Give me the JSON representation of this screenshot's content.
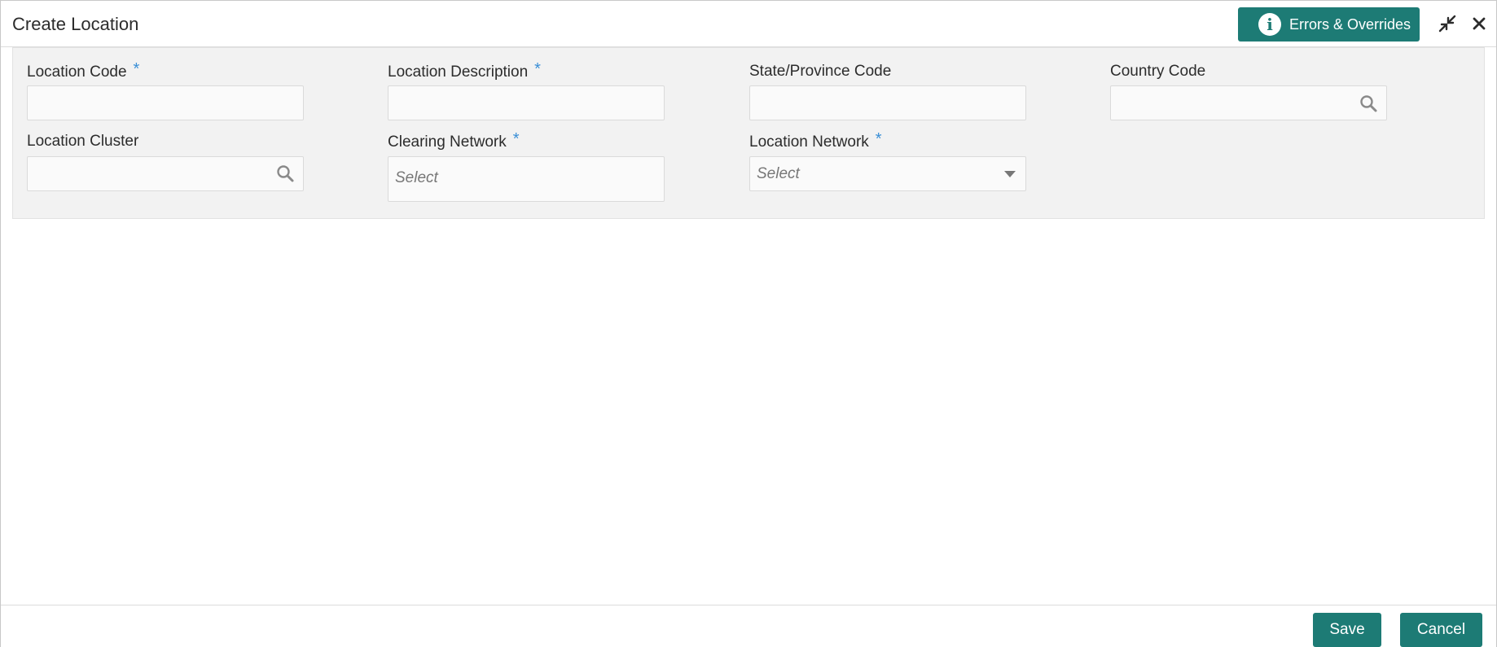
{
  "window": {
    "title": "Create Location"
  },
  "header": {
    "errors_button_label": "Errors & Overrides",
    "info_icon_glyph": "i",
    "icons": {
      "info": "info-icon",
      "minimize": "minimize-icon",
      "close": "close-icon"
    }
  },
  "form": {
    "fields": [
      {
        "label": "Location Code",
        "required": "*",
        "value": "",
        "type": "text"
      },
      {
        "label": "Location Description",
        "required": "*",
        "value": "",
        "type": "text"
      },
      {
        "label": "State/Province Code",
        "required": "",
        "value": "",
        "type": "text"
      },
      {
        "label": "Country Code",
        "required": "",
        "value": "",
        "type": "lookup",
        "icon": "search-icon"
      },
      {
        "label": "Location Cluster",
        "required": "",
        "value": "",
        "type": "lookup",
        "icon": "search-icon"
      },
      {
        "label": "Clearing Network",
        "required": "*",
        "placeholder": "Select",
        "type": "multiselect"
      },
      {
        "label": "Location Network",
        "required": "*",
        "placeholder": "Select",
        "type": "select",
        "icon": "chevron-down-icon"
      }
    ]
  },
  "footer": {
    "save_label": "Save",
    "cancel_label": "Cancel"
  },
  "colors": {
    "accent": "#1d7b75",
    "required_marker": "#3a8fd6",
    "panel_background": "#f2f2f2"
  }
}
